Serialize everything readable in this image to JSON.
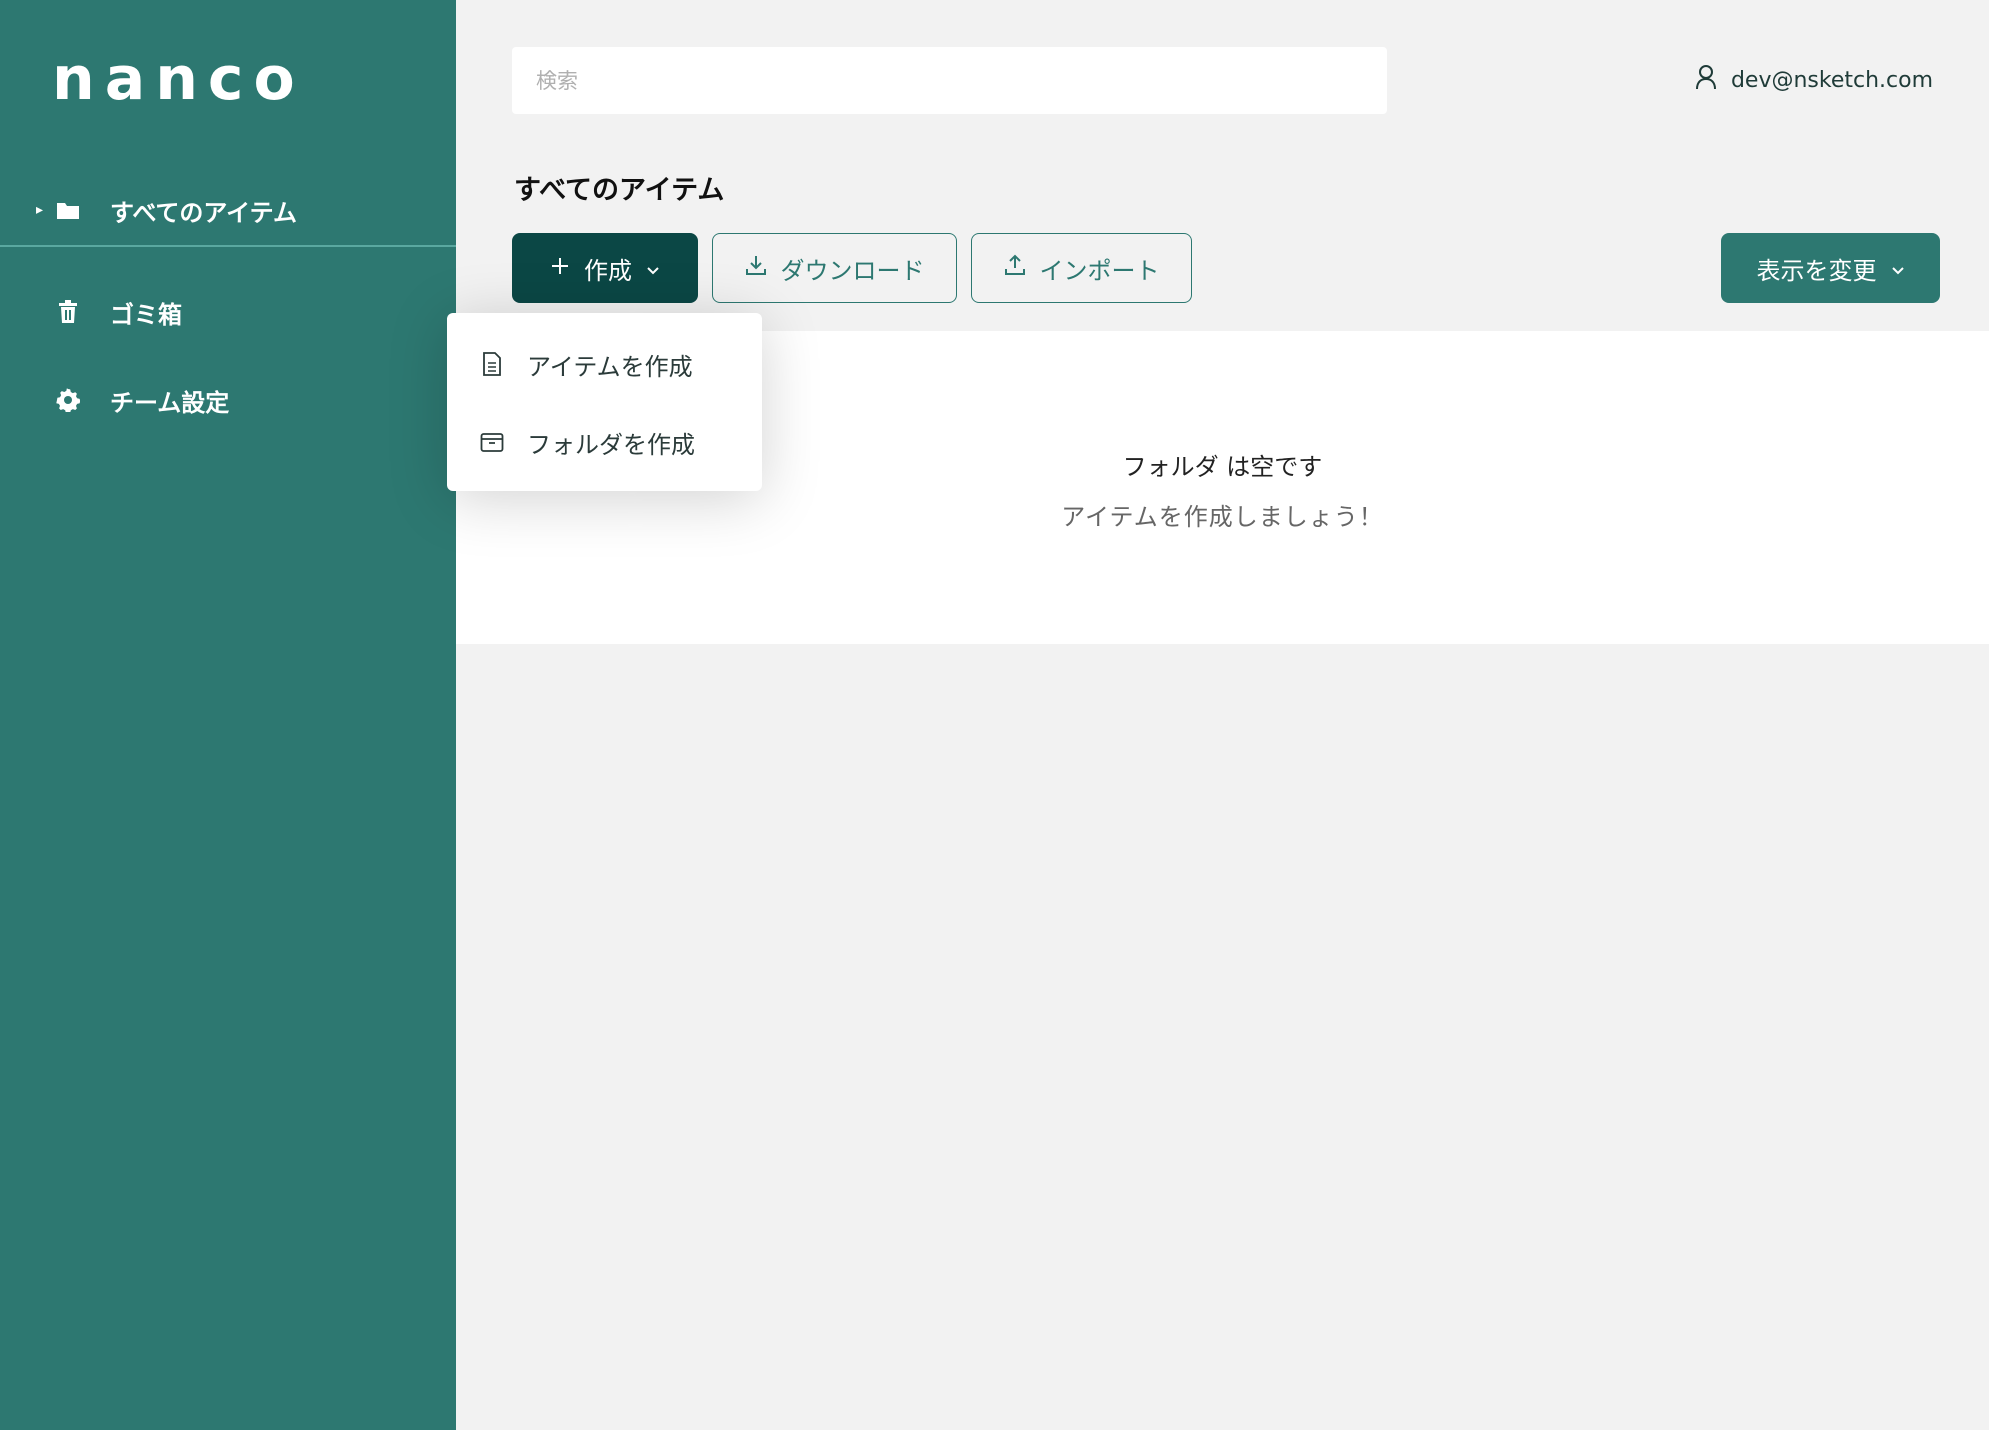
{
  "sidebar": {
    "logo": "nanco",
    "items": [
      {
        "label": "すべてのアイテム",
        "icon": "folder-icon"
      },
      {
        "label": "ゴミ箱",
        "icon": "trash-icon"
      },
      {
        "label": "チーム設定",
        "icon": "gear-icon"
      }
    ]
  },
  "header": {
    "search_placeholder": "検索",
    "user_email": "dev@nsketch.com"
  },
  "main": {
    "title": "すべてのアイテム",
    "create_label": "作成",
    "download_label": "ダウンロード",
    "import_label": "インポート",
    "view_label": "表示を変更",
    "empty_title": "フォルダ は空です",
    "empty_sub": "アイテムを作成しましょう！"
  },
  "dropdown": {
    "items": [
      {
        "label": "アイテムを作成",
        "icon": "document-icon"
      },
      {
        "label": "フォルダを作成",
        "icon": "folder-box-icon"
      }
    ]
  },
  "colors": {
    "sidebar": "#2d7871",
    "primary_dark": "#0b4745",
    "background": "#f2f2f2"
  }
}
